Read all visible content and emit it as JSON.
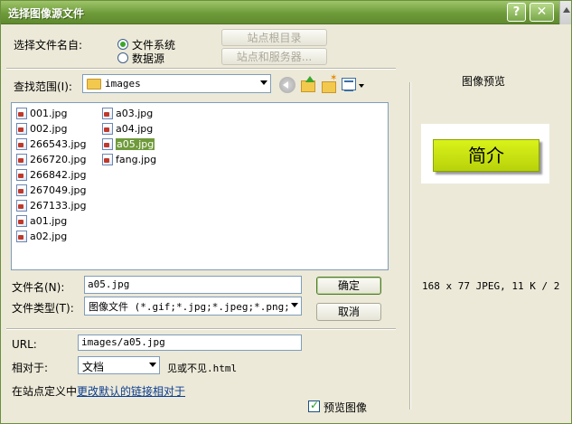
{
  "window": {
    "title": "选择图像源文件",
    "help_glyph": "?",
    "close_glyph": "✕"
  },
  "select_from": {
    "label": "选择文件名自:",
    "options": [
      {
        "label": "文件系统",
        "selected": true
      },
      {
        "label": "数据源",
        "selected": false
      }
    ]
  },
  "site_buttons": {
    "site_root": "站点根目录",
    "site_server": "站点和服务器..."
  },
  "lookin": {
    "label": "查找范围(I):",
    "value": "images"
  },
  "files": {
    "column1": [
      "001.jpg",
      "002.jpg",
      "266543.jpg",
      "266720.jpg",
      "266842.jpg",
      "267049.jpg",
      "267133.jpg",
      "a01.jpg",
      "a02.jpg"
    ],
    "column2": [
      "a03.jpg",
      "a04.jpg",
      "a05.jpg",
      "fang.jpg"
    ],
    "selected": "a05.jpg"
  },
  "filename": {
    "label": "文件名(N):",
    "value": "a05.jpg"
  },
  "filetype": {
    "label": "文件类型(T):",
    "value": "图像文件 (*.gif;*.jpg;*.jpeg;*.png;*"
  },
  "buttons": {
    "ok": "确定",
    "cancel": "取消"
  },
  "url": {
    "label": "URL:",
    "value": "images/a05.jpg"
  },
  "relative": {
    "label": "相对于:",
    "value": "文档",
    "doc_name": "见或不见.html"
  },
  "site_def": {
    "prefix": "在站点定义中",
    "link": "更改默认的链接相对于"
  },
  "preview": {
    "title": "图像预览",
    "image_text": "简介",
    "info": "168 x 77 JPEG, 11 K / 2",
    "checkbox_label": "预览图像",
    "checked": true
  },
  "colors": {
    "titlebar": "#6e9b3a",
    "selection": "#6f9a3b",
    "preview_bg": "#d9f21a"
  }
}
